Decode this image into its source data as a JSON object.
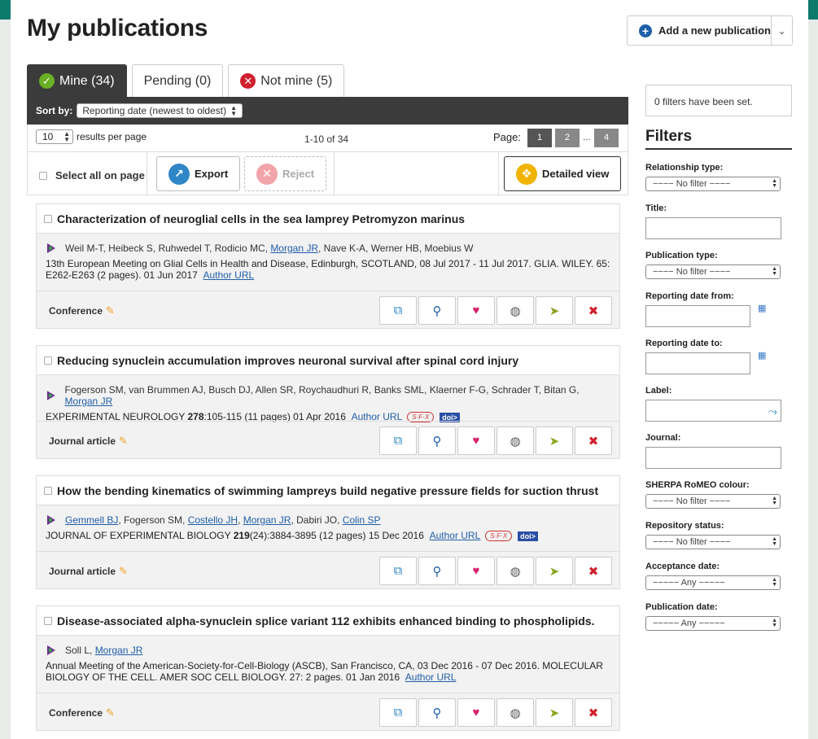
{
  "page": {
    "title": "My publications"
  },
  "add_button": {
    "label": "Add a new publication"
  },
  "tabs": [
    {
      "label": "Mine (34)",
      "icon": "check-icon"
    },
    {
      "label": "Pending (0)"
    },
    {
      "label": "Not mine (5)",
      "icon": "x-icon"
    }
  ],
  "sort": {
    "label": "Sort by:",
    "value": "Reporting date (newest to oldest)"
  },
  "pager": {
    "per_page_value": "10",
    "per_page_label": "results per page",
    "range": "1-10 of 34",
    "page_label": "Page:",
    "pages": [
      "1",
      "2",
      "4"
    ],
    "ellipsis": "..."
  },
  "actions": {
    "select_all": "Select all on page",
    "export": "Export",
    "reject": "Reject",
    "detailed_view": "Detailed view"
  },
  "publications": [
    {
      "title": "Characterization of neuroglial cells in the sea lamprey Petromyzon marinus",
      "authors_pre": "Weil M-T, Heibeck S, Ruhwedel T, Rodicio MC, ",
      "authors_link": "Morgan JR",
      "authors_post": ", Nave K-A, Werner HB, Moebius W",
      "cite": "13th European Meeting on Glial Cells in Health and Disease, Edinburgh, SCOTLAND, 08 Jul 2017 - 11 Jul 2017. GLIA. WILEY. 65: E262-E263 (2 pages). 01 Jun 2017",
      "author_url": "Author URL",
      "type": "Conference"
    },
    {
      "title": "Reducing synuclein accumulation improves neuronal survival after spinal cord injury",
      "authors_pre": "Fogerson SM, van Brummen AJ, Busch DJ, Allen SR, Roychaudhuri R, Banks SML, Klaerner F-G, Schrader T, Bitan G, ",
      "authors_link": "Morgan JR",
      "cite_journal": "EXPERIMENTAL NEUROLOGY ",
      "cite_vol": "278",
      "cite_rest": ":105-115 (11 pages) 01 Apr 2016",
      "author_url": "Author URL",
      "sfx": "S·F·X",
      "doi": "doi>",
      "type": "Journal article"
    },
    {
      "title": "How the bending kinematics of swimming lampreys build negative pressure fields for suction thrust",
      "author1": "Gemmell BJ",
      "sep1": ", Fogerson SM, ",
      "author2": "Costello JH",
      "sep2": ", ",
      "author3": "Morgan JR",
      "sep3": ", Dabiri JO, ",
      "author4": "Colin SP",
      "cite_journal": "JOURNAL OF EXPERIMENTAL BIOLOGY ",
      "cite_vol": "219",
      "cite_rest": "(24):3884-3895 (12 pages) 15 Dec 2016",
      "author_url": "Author URL",
      "sfx": "S·F·X",
      "doi": "doi>",
      "type": "Journal article"
    },
    {
      "title": "Disease-associated alpha-synuclein splice variant 112 exhibits enhanced binding to phospholipids.",
      "authors_pre": "Soll L, ",
      "authors_link": "Morgan JR",
      "cite": "Annual Meeting of the American-Society-for-Cell-Biology (ASCB), San Francisco, CA, 03 Dec 2016 - 07 Dec 2016. MOLECULAR BIOLOGY OF THE CELL. AMER SOC CELL BIOLOGY. 27: 2 pages. 01 Jan 2016",
      "author_url": "Author URL",
      "type": "Conference"
    }
  ],
  "sidebar": {
    "filter_count": "0 filters have been set.",
    "heading": "Filters",
    "relationship_type": {
      "label": "Relationship type:",
      "value": "−−−− No filter −−−−"
    },
    "title": {
      "label": "Title:"
    },
    "publication_type": {
      "label": "Publication type:",
      "value": "−−−− No filter −−−−"
    },
    "reporting_from": {
      "label": "Reporting date from:"
    },
    "reporting_to": {
      "label": "Reporting date to:"
    },
    "label": {
      "label": "Label:"
    },
    "journal": {
      "label": "Journal:"
    },
    "sherpa": {
      "label": "SHERPA RoMEO colour:",
      "value": "−−−− No filter −−−−"
    },
    "repository": {
      "label": "Repository status:",
      "value": "−−−− No filter −−−−"
    },
    "acceptance": {
      "label": "Acceptance date:",
      "value": "−−−−− Any −−−−−"
    },
    "publication_date": {
      "label": "Publication date:",
      "value": "−−−−− Any −−−−−"
    }
  }
}
